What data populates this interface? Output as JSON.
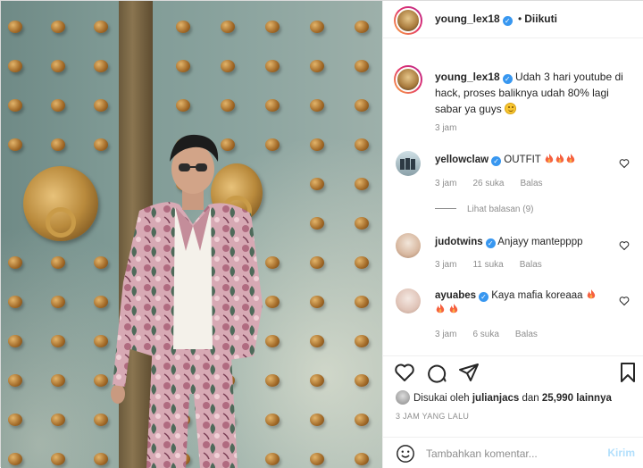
{
  "post": {
    "username": "young_lex18",
    "verified": true,
    "separator": "•",
    "follow_status": "Diikuti",
    "caption": "Udah 3 hari youtube di hack, proses baliknya udah 80% lagi sabar ya guys",
    "caption_emoji": "smiling-face-icon",
    "caption_time": "3 jam"
  },
  "comments": [
    {
      "username": "yellowclaw",
      "verified": true,
      "text": "OUTFIT",
      "emoji": [
        "fire-icon",
        "fire-icon",
        "fire-icon"
      ],
      "time": "3 jam",
      "likes": "26 suka",
      "reply": "Balas",
      "view_replies": "Lihat balasan (9)"
    },
    {
      "username": "judotwins",
      "verified": true,
      "text": "Anjayy mantepppp",
      "emoji": [],
      "time": "3 jam",
      "likes": "11 suka",
      "reply": "Balas"
    },
    {
      "username": "ayuabes",
      "verified": true,
      "text": "Kaya mafia koreaaa",
      "emoji": [
        "fire-icon",
        "fire-icon",
        "fire-icon"
      ],
      "time": "3 jam",
      "likes": "6 suka",
      "reply": "Balas"
    }
  ],
  "likes_line": {
    "prefix": "Disukai oleh",
    "user": "julianjacs",
    "middle": "dan",
    "count": "25,990 lainnya"
  },
  "posted_ago": "3 JAM YANG LALU",
  "comment_box": {
    "placeholder": "Tambahkan komentar...",
    "send_label": "Kirim"
  },
  "colors": {
    "verified": "#3897f0",
    "muted_text": "#8e8e8e",
    "send_disabled": "#b2dffc",
    "fire": "#f56040"
  }
}
